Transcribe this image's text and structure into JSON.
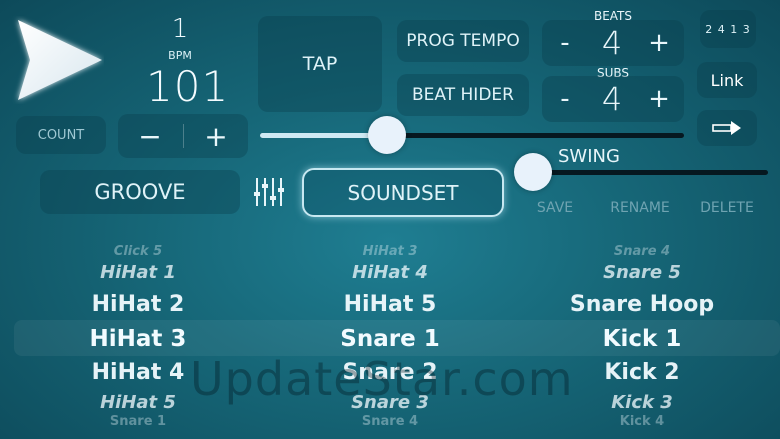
{
  "transport": {
    "play_icon": "play-icon"
  },
  "bpm": {
    "beat": "1",
    "label": "BPM",
    "value": "101"
  },
  "buttons": {
    "tap": "TAP",
    "prog_tempo": "PROG TEMPO",
    "beat_hider": "BEAT HIDER",
    "count": "COUNT",
    "groove": "GROOVE",
    "soundset": "SOUNDSET",
    "link": "Link",
    "save": "SAVE",
    "rename": "RENAME",
    "delete": "DELETE"
  },
  "beats": {
    "label": "BEATS",
    "value": "4",
    "minus": "-",
    "plus": "+"
  },
  "subs": {
    "label": "SUBS",
    "value": "4",
    "minus": "-",
    "plus": "+"
  },
  "tempo_adjust": {
    "minus": "−",
    "plus": "+"
  },
  "tempo_slider": {
    "level": 0.3
  },
  "swing": {
    "label": "SWING",
    "level": 0.0
  },
  "pattern_icon_text": "2 4 1 3",
  "pickers": [
    {
      "items": [
        "Click 5",
        "HiHat 1",
        "HiHat 2",
        "HiHat 3",
        "HiHat 4",
        "HiHat 5",
        "Snare 1"
      ]
    },
    {
      "items": [
        "HiHat 3",
        "HiHat 4",
        "HiHat 5",
        "Snare 1",
        "Snare 2",
        "Snare 3",
        "Snare 4"
      ]
    },
    {
      "items": [
        "Snare 4",
        "Snare 5",
        "Snare Hoop",
        "Kick 1",
        "Kick 2",
        "Kick 3",
        "Kick 4"
      ]
    }
  ],
  "watermark": "UpdateStar.com",
  "colors": {
    "accent": "#cfe9f3",
    "background": "#166677",
    "track": "#061820"
  }
}
